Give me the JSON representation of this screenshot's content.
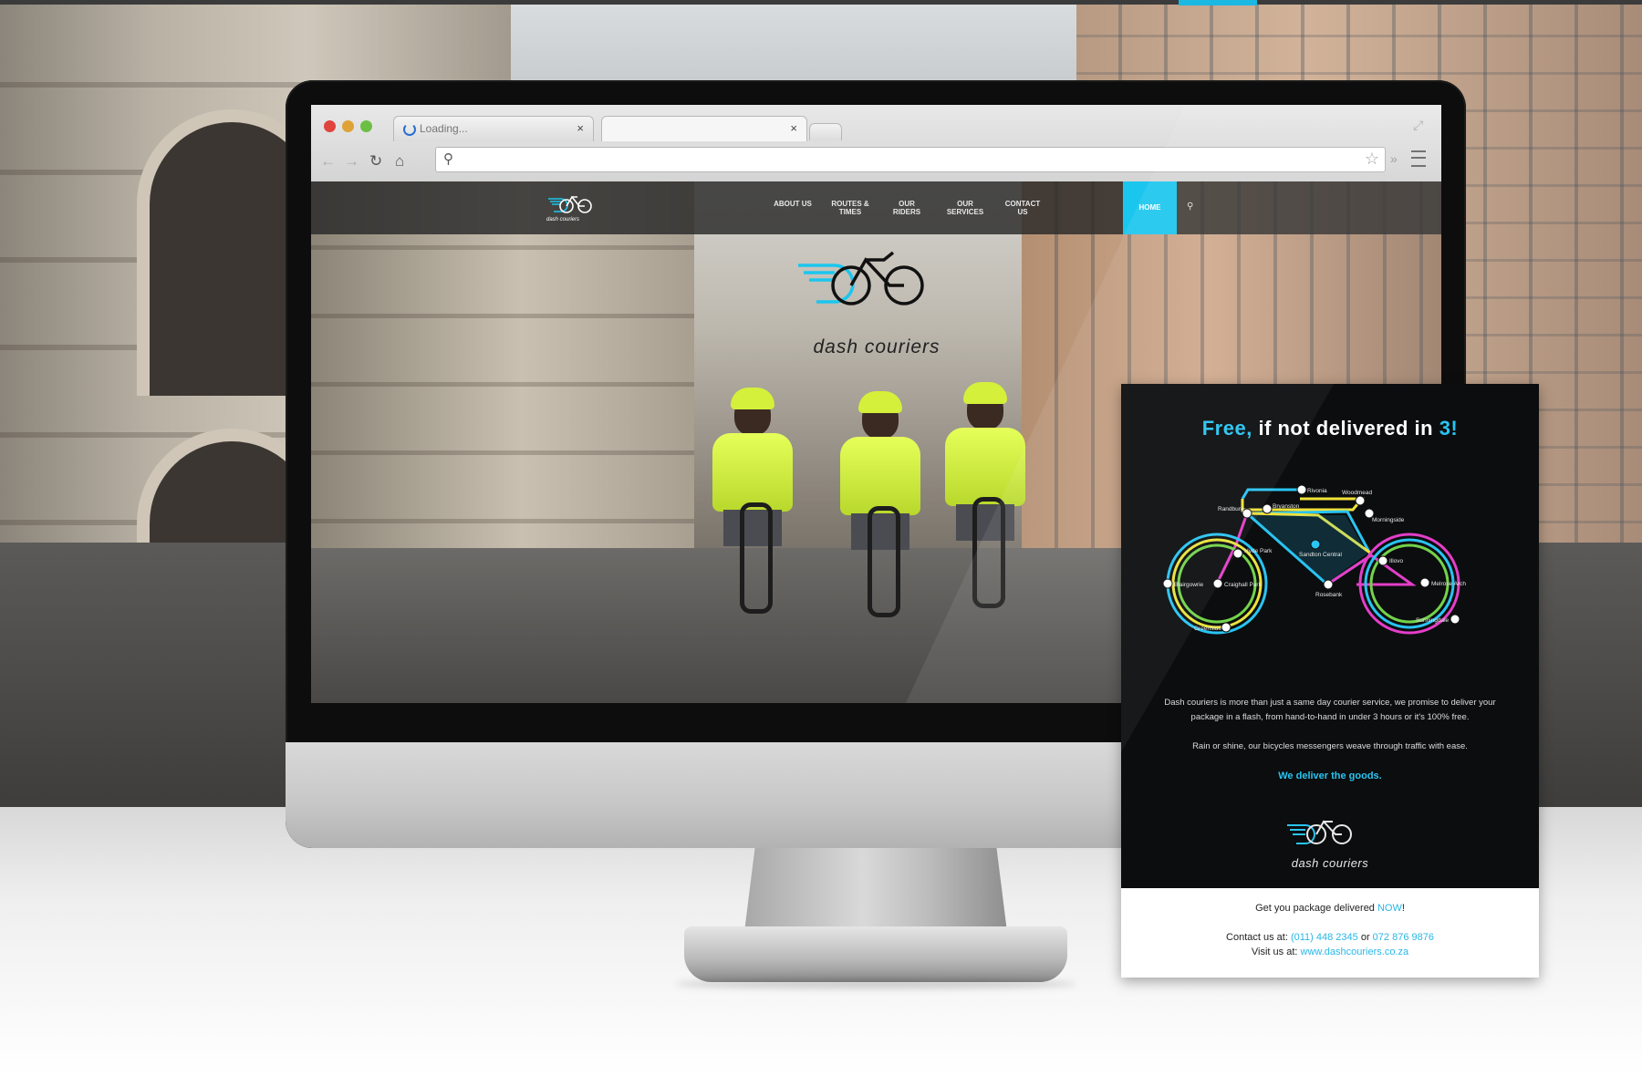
{
  "colors": {
    "accent": "#1bc6ee",
    "flyer_accent": "#29c4f2",
    "dark": "#0b0d0e"
  },
  "browser": {
    "tab_loading_title": "Loading...",
    "tab_close": "×",
    "nav_back": "←",
    "nav_forward": "→",
    "nav_reload": "↻",
    "nav_home": "⌂",
    "search_icon": "search-icon",
    "star_icon": "☆",
    "chevron": "»"
  },
  "site": {
    "brand": "dash couriers",
    "nav": {
      "about": "ABOUT US",
      "routes": "ROUTES & TIMES",
      "riders": "OUR RIDERS",
      "services": "OUR SERVICES",
      "contact": "CONTACT US",
      "home": "HOME"
    },
    "hero_brand": "dash couriers"
  },
  "flyer": {
    "headline_a": "Free,",
    "headline_b": " if not delivered in ",
    "headline_c": "3!",
    "map_stations": {
      "rivonia": "Rivonia",
      "bryanston": "Bryanston",
      "woodmead": "Woodmead",
      "randburg": "Randburg",
      "morningside": "Morningside",
      "hyde_park": "Hyde Park",
      "sandton": "Sandton Central",
      "illovo": "Illovo",
      "blairgowrie": "Blairgowrie",
      "craighall": "Craighall Park",
      "melrose": "Melrose Arch",
      "rosebank": "Rosebank",
      "sunningdale": "Sunningdale",
      "greenside": "Greenside"
    },
    "para1": "Dash couriers is more than just a same day courier service, we promise to deliver your package in a flash, from hand-to-hand in under 3 hours or it's 100% free.",
    "para2": "Rain or shine, our bicycles messengers weave through traffic with ease.",
    "cta": "We deliver the goods.",
    "brand": "dash couriers",
    "footer": {
      "get_prefix": "Get you package delivered ",
      "get_now": "NOW",
      "get_suffix": "!",
      "contact_prefix": "Contact us at: ",
      "phone1": "(011) 448 2345",
      "or": " or ",
      "phone2": "072 876 9876",
      "visit_prefix": "Visit us at: ",
      "url": "www.dashcouriers.co.za"
    }
  }
}
